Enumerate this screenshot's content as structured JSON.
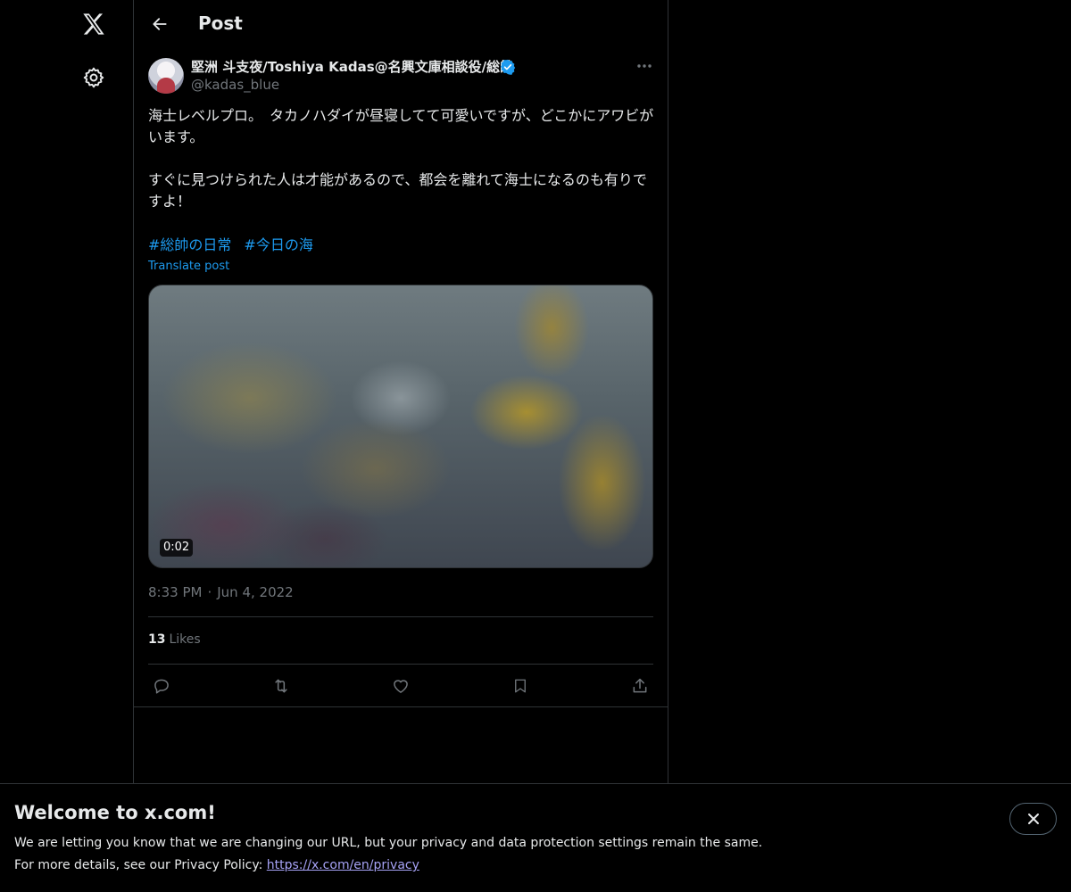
{
  "header": {
    "title": "Post"
  },
  "post": {
    "author_name": "堅洲 斗支夜/Toshiya Kadas@名興文庫相談役/総帥",
    "author_handle": "@kadas_blue",
    "text": "海士レベルプロ。　タカノハダイが昼寝してて可愛いですが、どこかにアワビがいます。\n\nすぐに見つけられた人は才能があるので、都会を離れて海士になるのも有りですよ！",
    "hashtags": [
      "#総帥の日常",
      "#今日の海"
    ],
    "translate_label": "Translate post",
    "video_duration": "0:02",
    "time": "8:33 PM",
    "separator": "·",
    "date": "Jun 4, 2022",
    "likes_count": "13",
    "likes_label": "Likes"
  },
  "icons": {
    "logo": "x-logo-icon",
    "settings": "gear-icon",
    "back": "back-arrow-icon",
    "verified": "verified-badge-icon",
    "more": "more-icon",
    "reply": "reply-icon",
    "repost": "repost-icon",
    "like": "heart-icon",
    "bookmark": "bookmark-icon",
    "share": "share-icon",
    "close": "close-icon"
  },
  "banner": {
    "title": "Welcome to x.com!",
    "line1": "We are letting you know that we are changing our URL, but your privacy and data protection settings remain the same.",
    "line2_prefix": "For more details, see our Privacy Policy: ",
    "link": "https://x.com/en/privacy"
  },
  "colors": {
    "background": "#000000",
    "text": "#e7e9ea",
    "muted": "#71767b",
    "accent": "#1d9bf0",
    "border": "#2f3336",
    "link": "#a6a2f5"
  }
}
